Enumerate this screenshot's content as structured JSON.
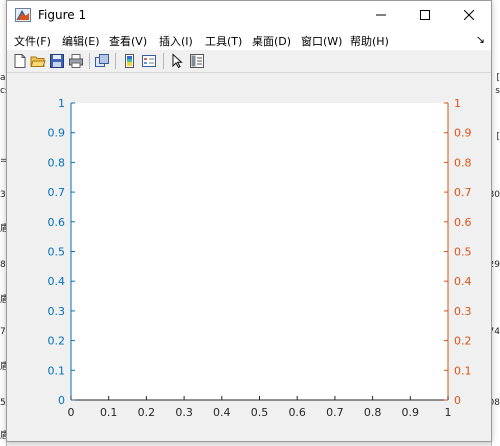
{
  "window": {
    "title": "Figure 1",
    "controls": {
      "minimize": "minimize",
      "maximize": "maximize",
      "close": "close"
    }
  },
  "menu": {
    "items": [
      "文件(F)",
      "编辑(E)",
      "查看(V)",
      "插入(I)",
      "工具(T)",
      "桌面(D)",
      "窗口(W)",
      "帮助(H)"
    ],
    "overflow": "↘"
  },
  "toolbar": {
    "icons": [
      "new-figure-icon",
      "open-file-icon",
      "save-icon",
      "print-icon",
      "link-plot-icon",
      "insert-colorbar-icon",
      "insert-legend-icon",
      "edit-plot-arrow-icon",
      "property-inspector-icon"
    ]
  },
  "background_fragments": {
    "left": [
      "a",
      "cs",
      "=",
      "3",
      "盾",
      "8",
      "盾",
      "7",
      "盾",
      "5",
      "盾"
    ],
    "right": [
      "[",
      "s",
      "[",
      "80",
      "29",
      "74",
      "08"
    ]
  },
  "chart_data": {
    "type": "line",
    "series": [],
    "xlim": [
      0,
      1
    ],
    "ylim_left": [
      0,
      1
    ],
    "ylim_right": [
      0,
      1
    ],
    "x_ticks": [
      "0",
      "0.1",
      "0.2",
      "0.3",
      "0.4",
      "0.5",
      "0.6",
      "0.7",
      "0.8",
      "0.9",
      "1"
    ],
    "y_left_ticks": [
      "0",
      "0.1",
      "0.2",
      "0.3",
      "0.4",
      "0.5",
      "0.6",
      "0.7",
      "0.8",
      "0.9",
      "1"
    ],
    "y_right_ticks": [
      "0",
      "0.1",
      "0.2",
      "0.3",
      "0.4",
      "0.5",
      "0.6",
      "0.7",
      "0.8",
      "0.9",
      "1"
    ],
    "colors": {
      "left_axis": "#0072bd",
      "right_axis": "#d95319",
      "x_axis": "#262626"
    },
    "grid": false
  }
}
